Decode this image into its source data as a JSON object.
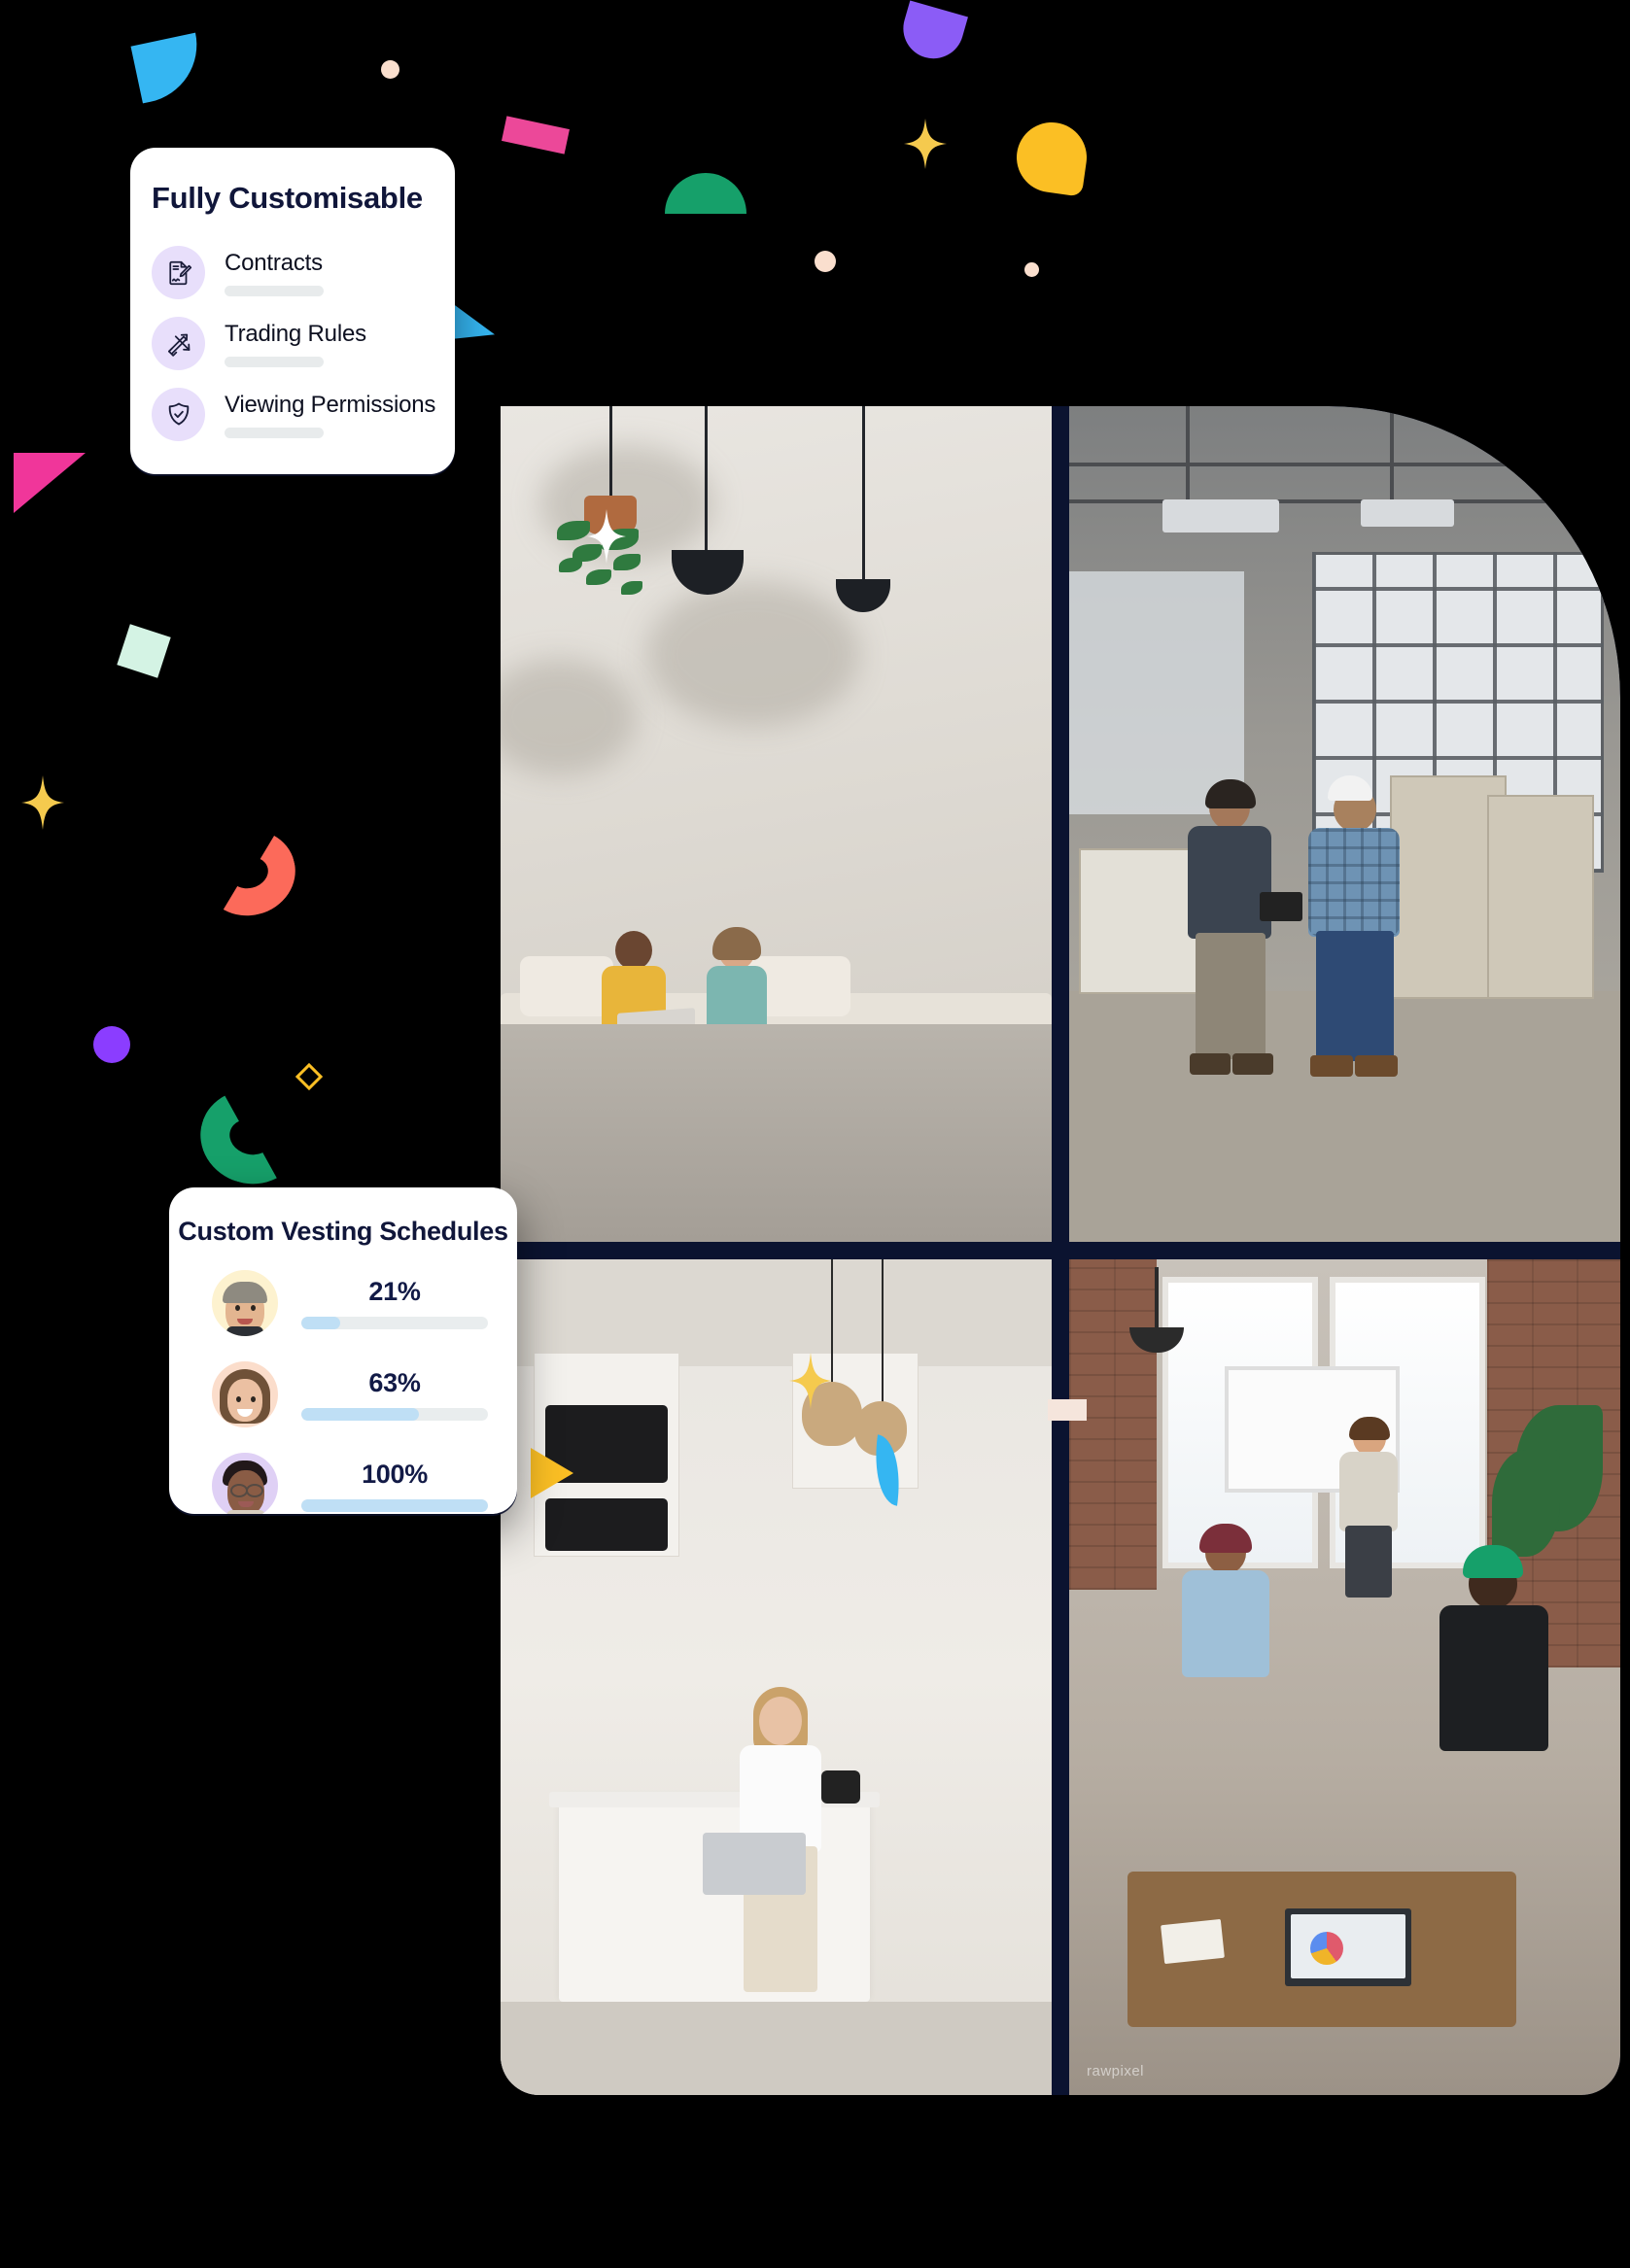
{
  "page": {
    "background_color": "#000000",
    "accent_navy": "#10163a"
  },
  "features_card": {
    "title": "Fully Customisable",
    "items": [
      {
        "label": "Contracts",
        "icon": "contract-signature-icon",
        "icon_bg": "#e8dffb",
        "icon_color": "#1b1d3a"
      },
      {
        "label": "Trading Rules",
        "icon": "exchange-arrows-icon",
        "icon_bg": "#e8dffb",
        "icon_color": "#1b1d3a"
      },
      {
        "label": "Viewing Permissions",
        "icon": "shield-check-icon",
        "icon_bg": "#e8dffb",
        "icon_color": "#1b1d3a"
      }
    ]
  },
  "vesting_card": {
    "title": "Custom Vesting Schedules",
    "rows": [
      {
        "percent_label": "21%",
        "percent_value": 21,
        "avatar_bg": "#fdf2cf",
        "avatar": "avatar-man-grey-hair"
      },
      {
        "percent_label": "63%",
        "percent_value": 63,
        "avatar_bg": "#fbddcb",
        "avatar": "avatar-woman-brown-hair"
      },
      {
        "percent_label": "100%",
        "percent_value": 100,
        "avatar_bg": "#dfd0f5",
        "avatar": "avatar-woman-glasses"
      }
    ],
    "track_color": "#e9edee",
    "fill_color": "#bfdff5",
    "percent_text_color": "#121a46"
  },
  "collage": {
    "photos": [
      {
        "name": "photo-cafe-wall-plant",
        "alt": "Plant and pendant lamps on a textured cafe wall"
      },
      {
        "name": "photo-warehouse-workers",
        "alt": "Two workers reviewing a tablet inside an industrial warehouse"
      },
      {
        "name": "photo-kitchen-laptop",
        "alt": "Woman holding a laptop in a bright modern kitchen"
      },
      {
        "name": "photo-meeting-room",
        "alt": "Team meeting with a whiteboard presentation in a brick loft office"
      }
    ],
    "watermark": "rawpixel"
  },
  "confetti": {
    "colors": {
      "blue": "#35b6f2",
      "purple": "#8b5cf6",
      "pink": "#ec4899",
      "magenta": "#f0369a",
      "green": "#16a06a",
      "yellow": "#fbbf24",
      "gold": "#f5ca4e",
      "coral": "#fc6a5a",
      "mint": "#d4f3e4",
      "peach": "#fadfce",
      "violet": "#8b3dff"
    }
  }
}
